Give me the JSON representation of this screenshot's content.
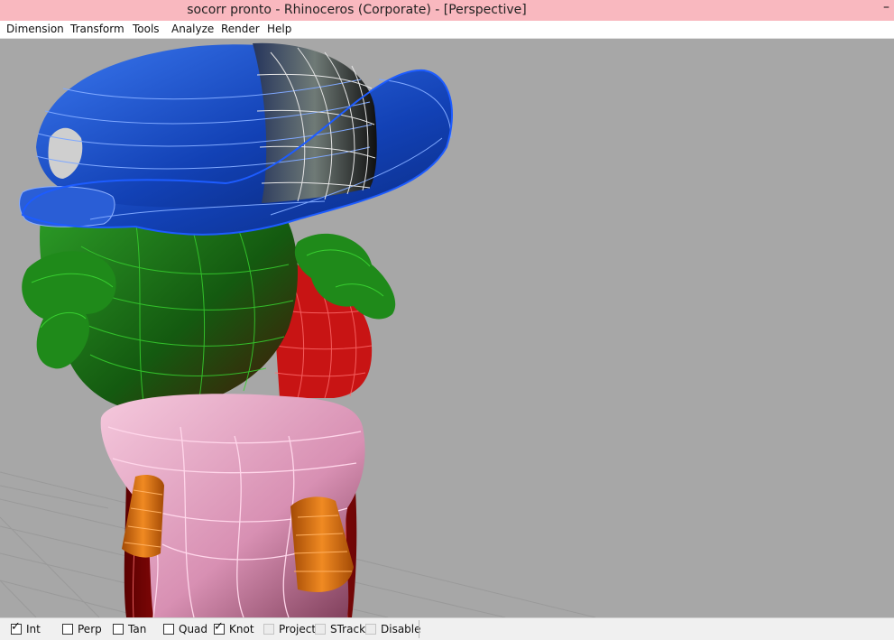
{
  "window": {
    "title": "socorr pronto - Rhinoceros (Corporate) - [Perspective]",
    "minimize_glyph": "–"
  },
  "menu": [
    {
      "label": "Dimension"
    },
    {
      "label": "Transform"
    },
    {
      "label": "Tools"
    },
    {
      "label": "Analyze"
    },
    {
      "label": "Render"
    },
    {
      "label": "Help"
    }
  ],
  "viewport": {
    "name": "Perspective",
    "background": "#a7a7a7",
    "object_colors": {
      "hat": "#1a4fd1",
      "head": "#157a12",
      "body": "#c81414",
      "collar": "#e8a6c8",
      "cuffs": "#e0761a"
    }
  },
  "osnaps": [
    {
      "label": "Int",
      "checked": true,
      "enabled": true
    },
    {
      "label": "Perp",
      "checked": false,
      "enabled": true
    },
    {
      "label": "Tan",
      "checked": false,
      "enabled": true
    },
    {
      "label": "Quad",
      "checked": false,
      "enabled": true
    },
    {
      "label": "Knot",
      "checked": true,
      "enabled": true
    },
    {
      "label": "Project",
      "checked": false,
      "enabled": false
    },
    {
      "label": "STrack",
      "checked": false,
      "enabled": false
    },
    {
      "label": "Disable",
      "checked": false,
      "enabled": false
    }
  ]
}
